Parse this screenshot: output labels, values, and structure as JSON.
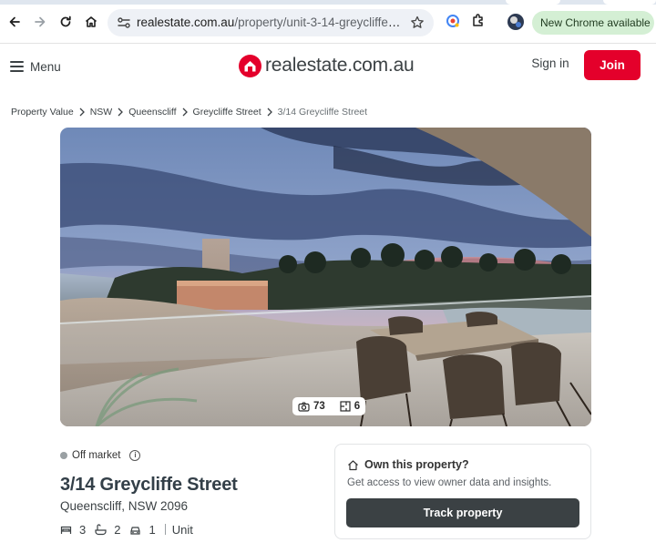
{
  "browser": {
    "url_host": "realestate.com.au",
    "url_path": "/property/unit-3-14-greycliffe-st-queenscliff-nsw-2096/",
    "update_pill": "New Chrome available"
  },
  "header": {
    "menu_label": "Menu",
    "logo_text": "realestate.com.au",
    "signin_label": "Sign in",
    "join_label": "Join",
    "brand_color": "#e4002b"
  },
  "breadcrumb": {
    "items": [
      "Property Value",
      "NSW",
      "Queenscliff",
      "Greycliffe Street",
      "3/14 Greycliffe Street"
    ]
  },
  "media": {
    "photo_count": "73",
    "floorplan_count": "6"
  },
  "property": {
    "status": "Off market",
    "title": "3/14 Greycliffe Street",
    "suburb": "Queenscliff, NSW 2096",
    "bedrooms": "3",
    "bathrooms": "2",
    "parking": "1",
    "type": "Unit"
  },
  "own_card": {
    "title": "Own this property?",
    "description": "Get access to view owner data and insights.",
    "button_label": "Track property"
  }
}
